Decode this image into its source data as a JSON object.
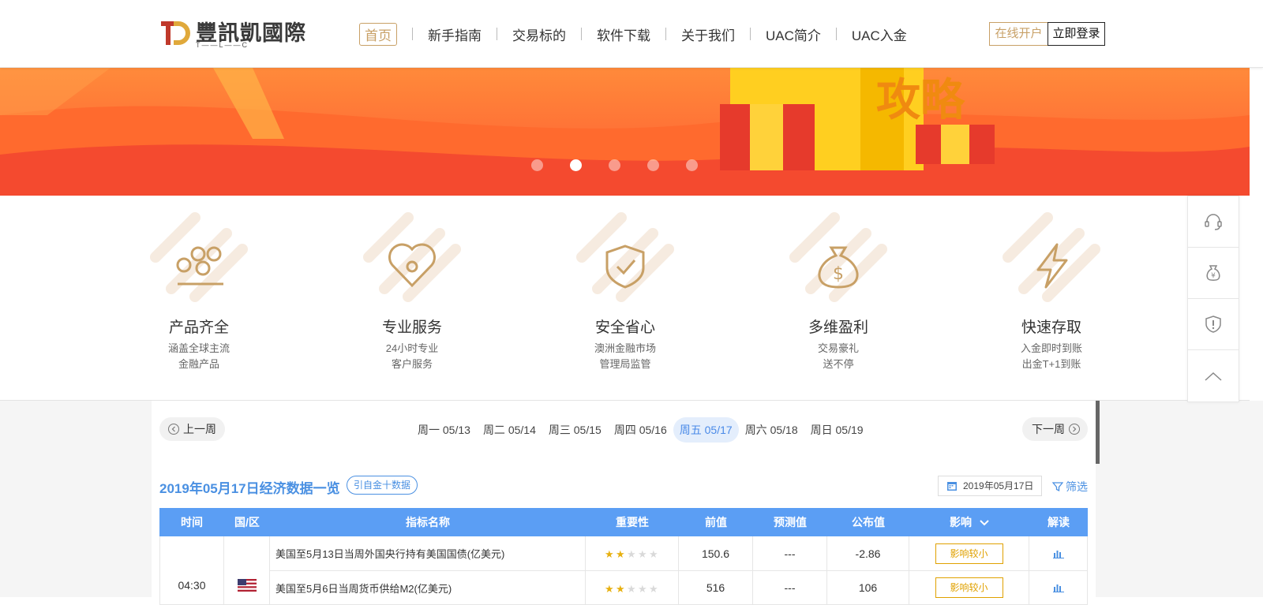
{
  "header": {
    "logo_text": "豐訊凱國際",
    "logo_sub": "T——L——C",
    "nav": [
      {
        "label": "首页",
        "active": true
      },
      {
        "label": "新手指南"
      },
      {
        "label": "交易标的"
      },
      {
        "label": "软件下载"
      },
      {
        "label": "关于我们"
      },
      {
        "label": "UAC简介"
      },
      {
        "label": "UAC入金"
      }
    ],
    "open_account": "在线开户",
    "login": "立即登录"
  },
  "banner": {
    "gift_text": "攻略",
    "slides": 5,
    "active_slide": 2
  },
  "features": [
    {
      "title": "产品齐全",
      "desc1": "涵盖全球主流",
      "desc2": "金融产品",
      "icon": "nodes-icon"
    },
    {
      "title": "专业服务",
      "desc1": "24小时专业",
      "desc2": "客户服务",
      "icon": "heart-icon"
    },
    {
      "title": "安全省心",
      "desc1": "澳洲金融市场",
      "desc2": "管理局监管",
      "icon": "shield-check-icon"
    },
    {
      "title": "多维盈利",
      "desc1": "交易豪礼",
      "desc2": "送不停",
      "icon": "money-bag-icon"
    },
    {
      "title": "快速存取",
      "desc1": "入金即时到账",
      "desc2": "出金T+1到账",
      "icon": "lightning-icon"
    }
  ],
  "sidebar": {
    "items": [
      "headset-icon",
      "yen-bag-icon",
      "alert-shield-icon",
      "back-to-top-icon"
    ]
  },
  "calendar": {
    "prev_week": "上一周",
    "next_week": "下一周",
    "days": [
      {
        "label": "周一 05/13"
      },
      {
        "label": "周二 05/14"
      },
      {
        "label": "周三 05/15"
      },
      {
        "label": "周四 05/16"
      },
      {
        "label": "周五 05/17",
        "active": true
      },
      {
        "label": "周六 05/18"
      },
      {
        "label": "周日 05/19"
      }
    ],
    "title": "2019年05月17日经济数据一览",
    "source": "引自金十数据",
    "date_value": "2019年05月17日",
    "filter": "筛选",
    "columns": [
      "时间",
      "国/区",
      "指标名称",
      "重要性",
      "前值",
      "预测值",
      "公布值",
      "影响",
      "解读"
    ],
    "rows": [
      {
        "time": "04:30",
        "country": "us-flag",
        "name": "美国至5月13日当周外国央行持有美国国债(亿美元)",
        "stars": 2,
        "prev": "150.6",
        "forecast": "---",
        "actual": "-2.86",
        "impact": "影响较小"
      },
      {
        "name": "美国至5月6日当周货币供给M2(亿美元)",
        "stars": 2,
        "prev": "516",
        "forecast": "---",
        "actual": "106",
        "impact": "影响较小"
      }
    ]
  },
  "colors": {
    "gold": "#c8a066",
    "blue": "#5b9ef4",
    "banner_red": "#f44a2f",
    "impact": "#e0a100"
  }
}
